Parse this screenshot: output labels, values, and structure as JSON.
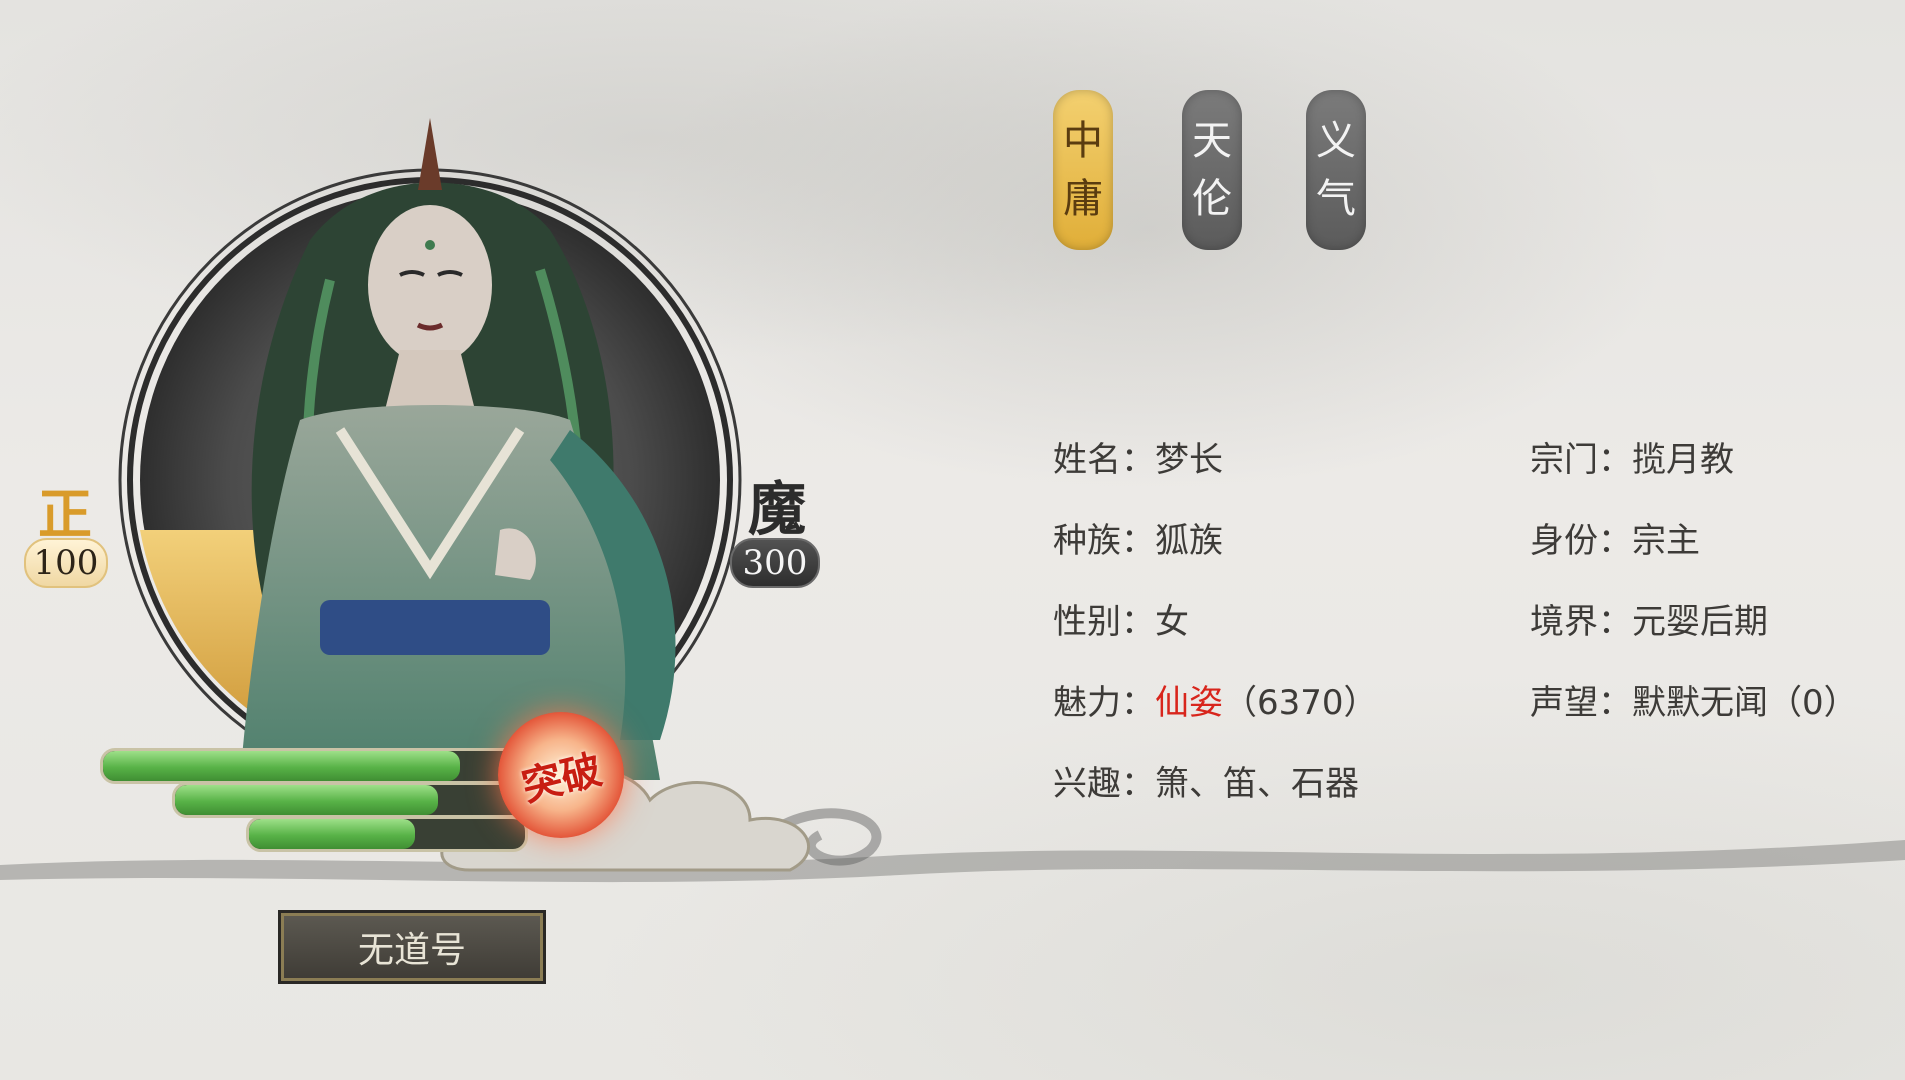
{
  "tabs": [
    {
      "label_top": "中",
      "label_bottom": "庸",
      "active": true
    },
    {
      "label_top": "天",
      "label_bottom": "伦",
      "active": false
    },
    {
      "label_top": "义",
      "label_bottom": "气",
      "active": false
    }
  ],
  "morality": {
    "righteous": {
      "label": "正",
      "value": "100"
    },
    "demonic": {
      "label": "魔",
      "value": "300"
    }
  },
  "progress_bars": [
    {
      "level": 0.85
    },
    {
      "level": 0.75
    },
    {
      "level": 0.6
    }
  ],
  "breakthrough_label": "突破",
  "title_button_label": "无道号",
  "info": {
    "name": {
      "label": "姓名：",
      "value": "梦长"
    },
    "race": {
      "label": "种族：",
      "value": "狐族"
    },
    "gender": {
      "label": "性别：",
      "value": "女"
    },
    "charm": {
      "label": "魅力：",
      "value": "仙姿",
      "extra": "（6370）"
    },
    "hobbies": {
      "label": "兴趣：",
      "value": "箫、笛、石器"
    },
    "sect": {
      "label": "宗门：",
      "value": "揽月教"
    },
    "identity": {
      "label": "身份：",
      "value": "宗主"
    },
    "realm": {
      "label": "境界：",
      "value": "元婴后期"
    },
    "reputation": {
      "label": "声望：",
      "value": "默默无闻（0）"
    }
  },
  "colors": {
    "active_tab": "#e0ae38",
    "inactive_tab": "#5b5b5b",
    "charm_highlight": "#d8251c",
    "bar_green": "#58b247"
  }
}
